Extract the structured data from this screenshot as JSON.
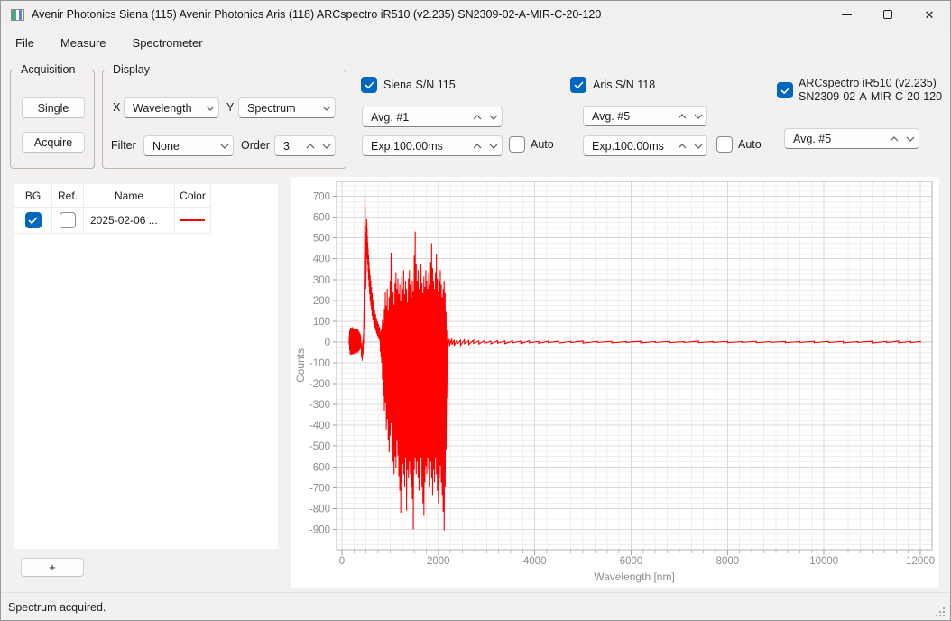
{
  "window": {
    "title": "Avenir Photonics Siena (115) Avenir Photonics Aris (118) ARCspectro iR510 (v2.235) SN2309-02-A-MIR-C-20-120"
  },
  "menu": {
    "items": [
      "File",
      "Measure",
      "Spectrometer"
    ]
  },
  "acquisition": {
    "title": "Acquisition",
    "single_label": "Single",
    "acquire_label": "Acquire"
  },
  "display": {
    "title": "Display",
    "x_label": "X",
    "x_value": "Wavelength",
    "y_label": "Y",
    "y_value": "Spectrum",
    "filter_label": "Filter",
    "filter_value": "None",
    "order_label": "Order",
    "order_value": "3"
  },
  "spectrometers": [
    {
      "label": "Siena S/N 115",
      "checked": true,
      "avg_value": "Avg. #1",
      "exp_value": "Exp.100.00ms",
      "auto_label": "Auto",
      "auto_checked": false
    },
    {
      "label": "Aris S/N 118",
      "checked": true,
      "avg_value": "Avg. #5",
      "exp_value": "Exp.100.00ms",
      "auto_label": "Auto",
      "auto_checked": false
    },
    {
      "label_line1": "ARCspectro iR510 (v2.235)",
      "label_line2": "SN2309-02-A-MIR-C-20-120",
      "checked": true,
      "avg_value": "Avg. #5"
    }
  ],
  "spectra_table": {
    "columns": [
      "BG",
      "Ref.",
      "Name",
      "Color"
    ],
    "rows": [
      {
        "bg_checked": true,
        "ref_checked": false,
        "name": "2025-02-06 ...",
        "color": "#ff0000"
      }
    ]
  },
  "add_button_label": "+",
  "status_text": "Spectrum acquired.",
  "accent_color": "#0067c0",
  "chart_data": {
    "type": "line",
    "title": "",
    "xlabel": "Wavelength [nm]",
    "ylabel": "Counts",
    "xlim": [
      -112,
      12242
    ],
    "ylim": [
      -998,
      772
    ],
    "x_ticks": [
      0,
      2000,
      4000,
      6000,
      8000,
      10000,
      12000
    ],
    "x_minor_step": 250,
    "y_ticks": [
      700,
      600,
      500,
      400,
      300,
      200,
      100,
      0,
      -100,
      -200,
      -300,
      -400,
      -500,
      -600,
      -700,
      -800,
      -900
    ],
    "y_minor_step": 25,
    "grid": true,
    "legend": false,
    "series": [
      {
        "name": "2025-02-06 ...",
        "color": "#ff0000",
        "points_format": "[wavelength_nm, counts_min, counts_max]",
        "points": [
          [
            150,
            -12,
            18
          ],
          [
            160,
            -40,
            52
          ],
          [
            170,
            -58,
            64
          ],
          [
            180,
            -48,
            70
          ],
          [
            190,
            -62,
            56
          ],
          [
            200,
            -50,
            68
          ],
          [
            210,
            -58,
            60
          ],
          [
            220,
            -44,
            72
          ],
          [
            230,
            -60,
            55
          ],
          [
            240,
            -52,
            66
          ],
          [
            250,
            -56,
            62
          ],
          [
            260,
            -46,
            64
          ],
          [
            270,
            -60,
            68
          ],
          [
            280,
            -50,
            58
          ],
          [
            290,
            -44,
            60
          ],
          [
            300,
            -56,
            64
          ],
          [
            310,
            -48,
            56
          ],
          [
            320,
            -40,
            60
          ],
          [
            330,
            -52,
            62
          ],
          [
            340,
            -44,
            54
          ],
          [
            350,
            -36,
            50
          ],
          [
            360,
            -42,
            46
          ],
          [
            370,
            -30,
            42
          ],
          [
            380,
            -34,
            38
          ],
          [
            390,
            -22,
            28
          ],
          [
            405,
            -75,
            -5
          ],
          [
            420,
            -90,
            -20
          ],
          [
            435,
            -60,
            10
          ],
          [
            448,
            -10,
            40
          ],
          [
            456,
            60,
            150
          ],
          [
            462,
            160,
            280
          ],
          [
            468,
            270,
            430
          ],
          [
            473,
            380,
            560
          ],
          [
            477,
            470,
            705
          ],
          [
            481,
            520,
            650
          ],
          [
            485,
            430,
            560
          ],
          [
            489,
            300,
            440
          ],
          [
            493,
            255,
            360
          ],
          [
            497,
            280,
            430
          ],
          [
            502,
            330,
            480
          ],
          [
            507,
            400,
            530
          ],
          [
            512,
            460,
            590
          ],
          [
            517,
            480,
            575
          ],
          [
            522,
            440,
            545
          ],
          [
            528,
            400,
            510
          ],
          [
            535,
            370,
            480
          ],
          [
            543,
            340,
            450
          ],
          [
            552,
            300,
            420
          ],
          [
            562,
            265,
            385
          ],
          [
            573,
            230,
            350
          ],
          [
            585,
            200,
            320
          ],
          [
            598,
            175,
            295
          ],
          [
            612,
            150,
            265
          ],
          [
            627,
            125,
            235
          ],
          [
            643,
            105,
            205
          ],
          [
            660,
            85,
            180
          ],
          [
            678,
            70,
            155
          ],
          [
            697,
            55,
            135
          ],
          [
            717,
            40,
            115
          ],
          [
            738,
            28,
            98
          ],
          [
            760,
            15,
            85
          ],
          [
            782,
            5,
            72
          ],
          [
            796,
            -45,
            45
          ],
          [
            810,
            -70,
            55
          ],
          [
            824,
            -100,
            65
          ],
          [
            840,
            -180,
            110
          ],
          [
            860,
            -260,
            90
          ],
          [
            880,
            -330,
            160
          ],
          [
            900,
            -290,
            240
          ],
          [
            920,
            -420,
            175
          ],
          [
            940,
            -370,
            255
          ],
          [
            960,
            -470,
            150
          ],
          [
            980,
            -530,
            215
          ],
          [
            1000,
            -450,
            295
          ],
          [
            1020,
            -390,
            430
          ],
          [
            1040,
            -510,
            375
          ],
          [
            1060,
            -575,
            240
          ],
          [
            1080,
            -635,
            180
          ],
          [
            1100,
            -550,
            285
          ],
          [
            1120,
            -605,
            335
          ],
          [
            1140,
            -475,
            255
          ],
          [
            1160,
            -545,
            305
          ],
          [
            1180,
            -645,
            230
          ],
          [
            1200,
            -715,
            275
          ],
          [
            1220,
            -820,
            200
          ],
          [
            1240,
            -675,
            315
          ],
          [
            1260,
            -585,
            255
          ],
          [
            1280,
            -635,
            345
          ],
          [
            1300,
            -695,
            230
          ],
          [
            1320,
            -555,
            295
          ],
          [
            1340,
            -810,
            255
          ],
          [
            1360,
            -615,
            190
          ],
          [
            1380,
            -655,
            305
          ],
          [
            1400,
            -575,
            345
          ],
          [
            1420,
            -635,
            275
          ],
          [
            1440,
            -695,
            215
          ],
          [
            1460,
            -755,
            295
          ],
          [
            1480,
            -900,
            245
          ],
          [
            1500,
            -615,
            415
          ],
          [
            1520,
            -555,
            530
          ],
          [
            1540,
            -635,
            375
          ],
          [
            1560,
            -575,
            295
          ],
          [
            1580,
            -655,
            345
          ],
          [
            1600,
            -715,
            255
          ],
          [
            1620,
            -635,
            305
          ],
          [
            1640,
            -555,
            375
          ],
          [
            1660,
            -695,
            285
          ],
          [
            1680,
            -775,
            235
          ],
          [
            1700,
            -835,
            315
          ],
          [
            1720,
            -675,
            265
          ],
          [
            1740,
            -595,
            345
          ],
          [
            1760,
            -635,
            295
          ],
          [
            1780,
            -555,
            255
          ],
          [
            1800,
            -615,
            335
          ],
          [
            1820,
            -695,
            275
          ],
          [
            1840,
            -575,
            385
          ],
          [
            1860,
            -655,
            475
          ],
          [
            1880,
            -735,
            355
          ],
          [
            1900,
            -615,
            295
          ],
          [
            1920,
            -675,
            255
          ],
          [
            1940,
            -555,
            335
          ],
          [
            1960,
            -635,
            425
          ],
          [
            1980,
            -715,
            305
          ],
          [
            2000,
            -775,
            245
          ],
          [
            2020,
            -655,
            295
          ],
          [
            2040,
            -595,
            345
          ],
          [
            2060,
            -675,
            275
          ],
          [
            2080,
            -735,
            215
          ],
          [
            2100,
            -815,
            255
          ],
          [
            2120,
            -905,
            295
          ],
          [
            2140,
            -695,
            235
          ],
          [
            2160,
            -515,
            145
          ],
          [
            2175,
            -270,
            55
          ],
          [
            2190,
            -15,
            10
          ],
          [
            2230,
            -20,
            14
          ],
          [
            2280,
            -12,
            16
          ],
          [
            2330,
            -18,
            10
          ],
          [
            2390,
            -10,
            12
          ],
          [
            2460,
            -16,
            8
          ],
          [
            2540,
            -8,
            10
          ],
          [
            2630,
            -12,
            6
          ],
          [
            2730,
            -7,
            9
          ],
          [
            2840,
            -10,
            5
          ],
          [
            2960,
            -6,
            7
          ],
          [
            3090,
            -9,
            4
          ],
          [
            3230,
            -5,
            6
          ],
          [
            3380,
            -8,
            5
          ],
          [
            3540,
            -4,
            5
          ],
          [
            3710,
            -7,
            4
          ],
          [
            3890,
            -4,
            6
          ],
          [
            4080,
            -6,
            3
          ],
          [
            4280,
            -3,
            4
          ],
          [
            4500,
            -5,
            4
          ],
          [
            4750,
            -3,
            3
          ],
          [
            5000,
            -5,
            5
          ],
          [
            5300,
            -2,
            3
          ],
          [
            5600,
            -4,
            3
          ],
          [
            5900,
            -2,
            2
          ],
          [
            6200,
            -4,
            4
          ],
          [
            6500,
            -2,
            2
          ],
          [
            6800,
            -3,
            3
          ],
          [
            7100,
            -2,
            2
          ],
          [
            7400,
            -3,
            4
          ],
          [
            7700,
            -2,
            2
          ],
          [
            8000,
            -3,
            3
          ],
          [
            8300,
            -2,
            2
          ],
          [
            8600,
            -3,
            3
          ],
          [
            8900,
            -2,
            2
          ],
          [
            9200,
            -3,
            3
          ],
          [
            9500,
            -2,
            2
          ],
          [
            9800,
            -3,
            3
          ],
          [
            10100,
            -2,
            3
          ],
          [
            10400,
            -4,
            3
          ],
          [
            10700,
            -2,
            2
          ],
          [
            11000,
            -5,
            4
          ],
          [
            11300,
            -3,
            3
          ],
          [
            11550,
            -4,
            5
          ],
          [
            11800,
            -3,
            3
          ],
          [
            12000,
            -3,
            3
          ]
        ]
      }
    ]
  }
}
